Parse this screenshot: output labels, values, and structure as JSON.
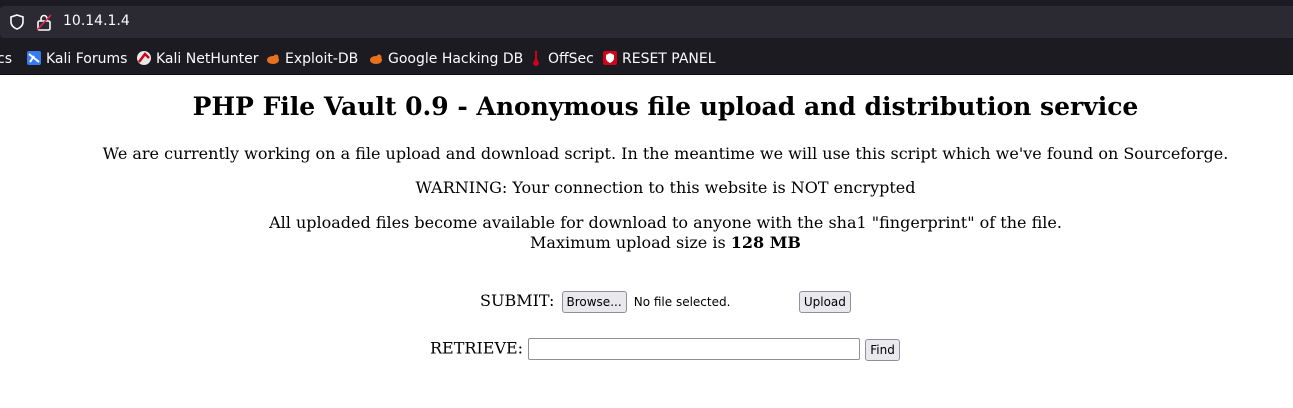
{
  "browser": {
    "url": "10.14.1.4",
    "bookmarks": [
      {
        "label": "cs",
        "icon": "kali-icon"
      },
      {
        "label": "Kali Forums",
        "icon": "kali-forums-icon"
      },
      {
        "label": "Kali NetHunter",
        "icon": "nethunter-icon"
      },
      {
        "label": "Exploit-DB",
        "icon": "exploitdb-icon"
      },
      {
        "label": "Google Hacking DB",
        "icon": "ghdb-icon"
      },
      {
        "label": "OffSec",
        "icon": "offsec-icon"
      },
      {
        "label": "RESET PANEL",
        "icon": "shield-icon"
      }
    ]
  },
  "page": {
    "title": "PHP File Vault 0.9 - Anonymous file upload and distribution service",
    "intro": "We are currently working on a file upload and download script. In the meantime we will use this script which we've found on Sourceforge.",
    "warning": "WARNING: Your connection to this website is NOT encrypted",
    "availability": "All uploaded files become available for download to anyone with the sha1 \"fingerprint\" of the file.",
    "max_size_prefix": "Maximum upload size is",
    "max_size_value": "128 MB",
    "submit": {
      "label": "SUBMIT:",
      "browse_button": "Browse...",
      "no_file": "No file selected.",
      "upload_button": "Upload"
    },
    "retrieve": {
      "label": "RETRIEVE:",
      "input_value": "",
      "find_button": "Find"
    }
  }
}
